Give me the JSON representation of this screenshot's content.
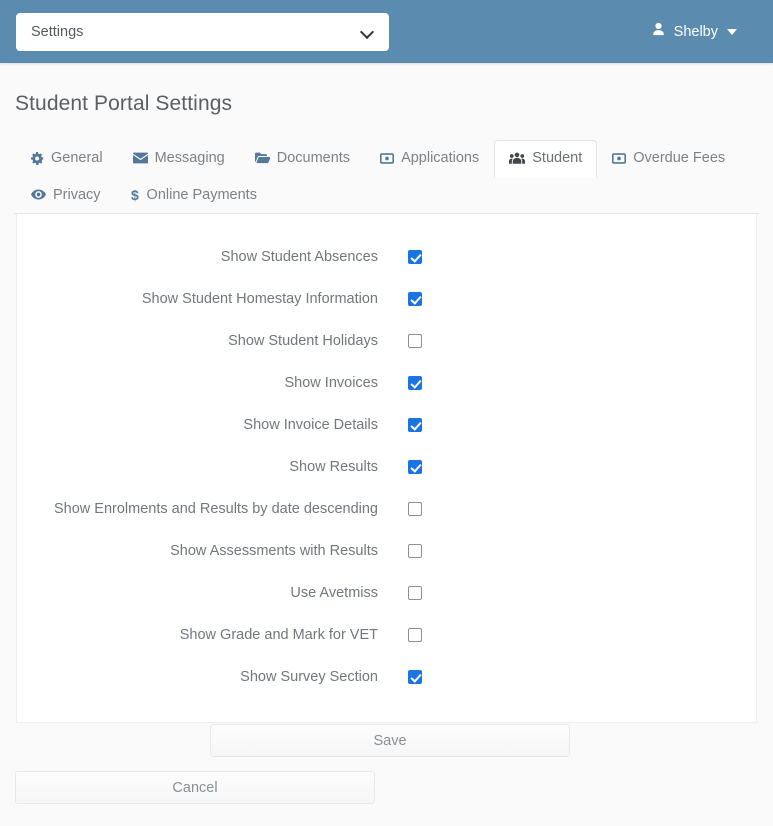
{
  "topbar": {
    "nav_select": {
      "value": "Settings",
      "icon": "chevron-down-icon"
    },
    "user": {
      "name": "Shelby",
      "icon": "user-icon",
      "caret": "caret-down-icon"
    }
  },
  "page": {
    "title": "Student Portal Settings"
  },
  "tabs": [
    {
      "label": "General",
      "icon": "gear-icon",
      "active": false
    },
    {
      "label": "Messaging",
      "icon": "envelope-icon",
      "active": false
    },
    {
      "label": "Documents",
      "icon": "folder-icon",
      "active": false
    },
    {
      "label": "Applications",
      "icon": "money-bill-icon",
      "active": false
    },
    {
      "label": "Student",
      "icon": "users-icon",
      "active": true
    },
    {
      "label": "Overdue Fees",
      "icon": "money-bill-icon",
      "active": false
    },
    {
      "label": "Privacy",
      "icon": "eye-icon",
      "active": false
    },
    {
      "label": "Online Payments",
      "icon": "dollar-icon",
      "active": false
    }
  ],
  "settings": [
    {
      "label": "Show Student Absences",
      "checked": true
    },
    {
      "label": "Show Student Homestay Information",
      "checked": true
    },
    {
      "label": "Show Student Holidays",
      "checked": false
    },
    {
      "label": "Show Invoices",
      "checked": true
    },
    {
      "label": "Show Invoice Details",
      "checked": true
    },
    {
      "label": "Show Results",
      "checked": true
    },
    {
      "label": "Show Enrolments and Results by date descending",
      "checked": false
    },
    {
      "label": "Show Assessments with Results",
      "checked": false
    },
    {
      "label": "Use Avetmiss",
      "checked": false
    },
    {
      "label": "Show Grade and Mark for VET",
      "checked": false
    },
    {
      "label": "Show Survey Section",
      "checked": true
    }
  ],
  "actions": {
    "save_label": "Save",
    "cancel_label": "Cancel"
  },
  "colors": {
    "header_bg": "#5b8cb0",
    "checkbox_accent": "#1b74e4",
    "tab_icon": "#53789a",
    "text_muted": "#72777c"
  }
}
